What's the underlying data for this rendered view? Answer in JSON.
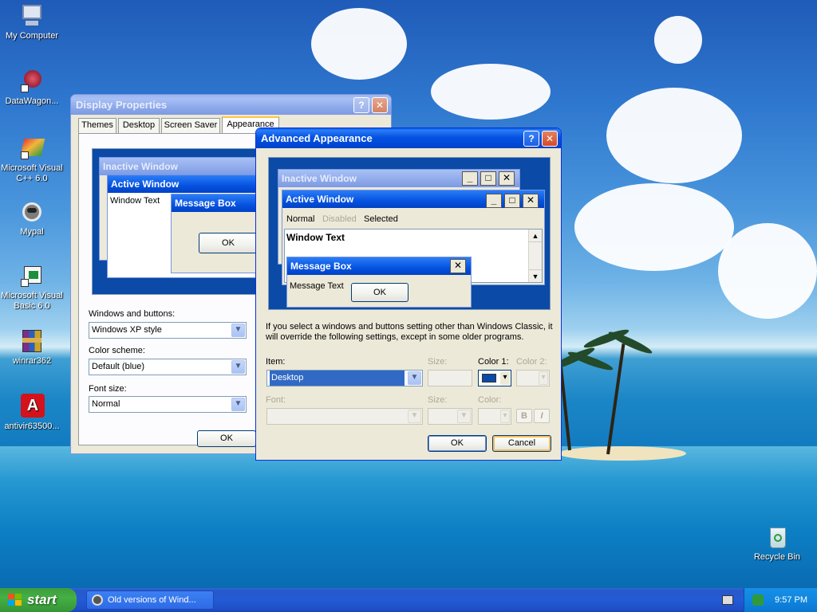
{
  "desktop": {
    "icons": [
      {
        "label": "My Computer",
        "icon": "computer-icon"
      },
      {
        "label": "DataWagon...",
        "icon": "datawagon-icon"
      },
      {
        "label": "Microsoft Visual C++ 6.0",
        "icon": "visual-cpp-icon"
      },
      {
        "label": "Mypal",
        "icon": "mypal-icon"
      },
      {
        "label": "Microsoft Visual Basic 6.0",
        "icon": "visual-basic-icon"
      },
      {
        "label": "winrar362",
        "icon": "winrar-icon"
      },
      {
        "label": "antivir63500...",
        "icon": "antivir-icon"
      },
      {
        "label": "Recycle Bin",
        "icon": "recycle-bin-icon"
      }
    ]
  },
  "display_properties": {
    "title": "Display Properties",
    "tabs": [
      "Themes",
      "Desktop",
      "Screen Saver",
      "Appearance"
    ],
    "active_tab": "Appearance",
    "preview": {
      "inactive_title": "Inactive Window",
      "active_title": "Active Window",
      "window_text": "Window Text",
      "message_box_title": "Message Box",
      "ok_label": "OK"
    },
    "windows_buttons_label": "Windows and buttons:",
    "windows_buttons_value": "Windows XP style",
    "color_scheme_label": "Color scheme:",
    "color_scheme_value": "Default (blue)",
    "font_size_label": "Font size:",
    "font_size_value": "Normal",
    "ok_label": "OK"
  },
  "advanced_appearance": {
    "title": "Advanced Appearance",
    "preview": {
      "inactive_title": "Inactive Window",
      "active_title": "Active Window",
      "menu_normal": "Normal",
      "menu_disabled": "Disabled",
      "menu_selected": "Selected",
      "window_text": "Window Text",
      "message_box_title": "Message Box",
      "message_text": "Message Text",
      "ok_label": "OK"
    },
    "info_text": "If you select a windows and buttons setting other than Windows Classic, it will override the following settings, except in some older programs.",
    "item_label": "Item:",
    "item_value": "Desktop",
    "size_label": "Size:",
    "color1_label": "Color 1:",
    "color2_label": "Color 2:",
    "font_label": "Font:",
    "font_size_label": "Size:",
    "font_color_label": "Color:",
    "bold_label": "B",
    "italic_label": "I",
    "ok_label": "OK",
    "cancel_label": "Cancel",
    "color1_swatch": "#0b4aa6"
  },
  "taskbar": {
    "start_label": "start",
    "task_item": "Old versions of Wind...",
    "clock": "9:57 PM"
  },
  "colors": {
    "xp_blue": "#0054e3",
    "dialog_bg": "#ece9d8",
    "start_green": "#3c9c3c"
  }
}
